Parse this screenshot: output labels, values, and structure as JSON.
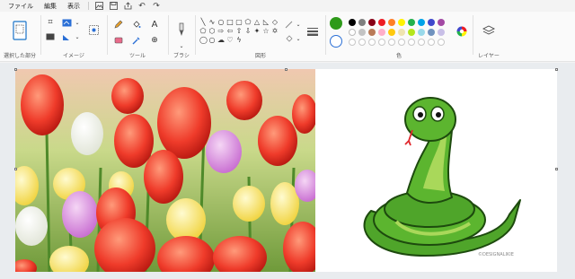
{
  "menu": {
    "file": "ファイル",
    "edit": "編集",
    "view": "表示"
  },
  "groups": {
    "selection": "選択した部分",
    "image": "イメージ",
    "tools": "ツール",
    "brushes": "ブラシ",
    "shapes": "図形",
    "colors": "色",
    "layers": "レイヤー"
  },
  "palette": {
    "current_color": "#2e9a1a",
    "row1": [
      "#000000",
      "#7f7f7f",
      "#880015",
      "#ed1c24",
      "#ff7f27",
      "#fff200",
      "#22b14c",
      "#00a2e8",
      "#3f48cc",
      "#a349a4"
    ],
    "row2": [
      "#ffffff",
      "#c3c3c3",
      "#b97a57",
      "#ffaec9",
      "#ffc90e",
      "#efe4b0",
      "#b5e61d",
      "#99d9ea",
      "#7092be",
      "#c8bfe7"
    ]
  },
  "canvas": {
    "credit": "©DESIGNALIKIE"
  }
}
